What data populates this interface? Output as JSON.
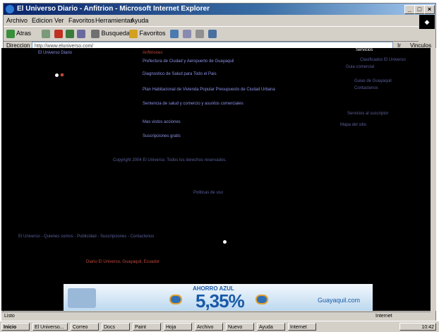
{
  "window": {
    "title": "El Universo Diario - Anfitrion - Microsoft Internet Explorer"
  },
  "menu": [
    "Archivo",
    "Edicion",
    "Ver",
    "Favoritos",
    "Herramientas",
    "Ayuda"
  ],
  "toolbar": {
    "back": "Atras",
    "search": "Busqueda",
    "favorites": "Favoritos"
  },
  "address": {
    "label": "Direccion",
    "value": "http://www.eluniverso.com/",
    "go": "Ir",
    "links": "Vinculos"
  },
  "content": {
    "left_link": "El Universo Diario",
    "section_title": "Anfitriones",
    "links": [
      "Prefectura de Ciudad y Aeropuerto de Guayaquil",
      "Diagnostico de Salud para Todo el Pais",
      "Plan Habitacional de Vivienda Popular Presupuesto de Ciudad Urbana",
      "Sentencia de salud y comercio y asuntos comerciales",
      "Mas vistos acciones",
      "Suscripciones gratis"
    ],
    "right_header": "Servicios",
    "right_links": [
      "Clasificados El Universo",
      "Guia comercial",
      "Guias de Guayaquil",
      "Contactenos",
      "Servicios al suscriptor",
      "Mapa del sitio"
    ],
    "footer_lines": [
      "Copyright 2004 El Universo. Todos los derechos reservados.",
      "Politicas de uso"
    ],
    "bottom_links": [
      "El Universo - Quienes somos - Publicidad - Suscripciones - Contactenos",
      "Diario El Universo, Guayaquil, Ecuador"
    ]
  },
  "banner": {
    "tag": "AHORRO AZUL",
    "rate": "5,35%",
    "brand": "Guayaquil.com"
  },
  "status": {
    "text": "Listo",
    "zone": "Internet"
  },
  "taskbar": {
    "start": "Inicio",
    "tasks": [
      "El Universo...",
      "Correo",
      "Docs",
      "Paint",
      "Hoja",
      "Archivo",
      "Nuevo",
      "Ayuda",
      "Internet"
    ],
    "clock": "10:42"
  }
}
